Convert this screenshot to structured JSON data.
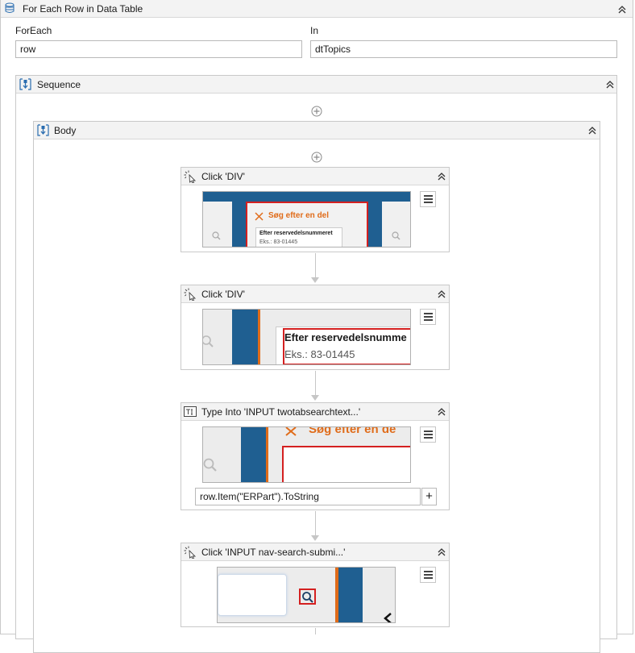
{
  "foreach_activity": {
    "title": "For Each Row in Data Table",
    "foreach_label": "ForEach",
    "foreach_value": "row",
    "in_label": "In",
    "in_value": "dtTopics"
  },
  "sequence": {
    "title": "Sequence"
  },
  "body": {
    "title": "Body"
  },
  "activities": [
    {
      "title": "Click 'DIV'",
      "thumb": {
        "heading": "Søg efter en del",
        "field_label": "Efter reservedelsnummeret",
        "field_hint": "Eks.: 83-01445"
      }
    },
    {
      "title": "Click 'DIV'",
      "thumb": {
        "field_label": "Efter reservedelsnumme",
        "field_hint": "Eks.: 83-01445"
      }
    },
    {
      "title": "Type Into 'INPUT  twotabsearchtext...'",
      "thumb": {
        "heading": "Søg efter en de"
      },
      "text_value": "row.Item(\"ERPart\").ToString",
      "plus_label": "+"
    },
    {
      "title": "Click 'INPUT  nav-search-submi...'"
    }
  ],
  "icons": {
    "datatable": "datatable-icon",
    "sequence": "sequence-icon",
    "click": "click-icon",
    "type_into": "type-into-icon",
    "collapse": "collapse-chevron-icon",
    "add": "add-activity-icon",
    "menu": "menu-icon"
  },
  "colors": {
    "orange": "#e06c1a",
    "navy": "#1f5f91",
    "red": "#d42020",
    "header_bg": "#f3f3f3"
  }
}
